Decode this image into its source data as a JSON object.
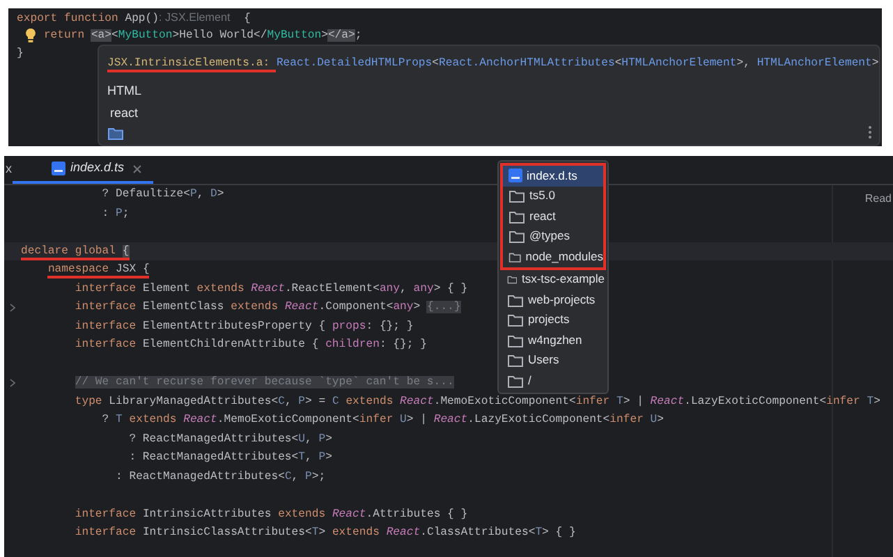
{
  "top_editor": {
    "lines": [
      {
        "kind": "code",
        "tokens": [
          {
            "text": "export function ",
            "kind": "keyword"
          },
          {
            "text": "App()",
            "kind": "plain"
          },
          {
            "text": ": JSX.Element",
            "kind": "hint"
          },
          {
            "text": "  {",
            "kind": "plain"
          }
        ]
      },
      {
        "kind": "code",
        "intention": true,
        "tokens": [
          {
            "text": "    return ",
            "kind": "keyword"
          },
          {
            "text": "<a>",
            "kind": "match"
          },
          {
            "text": "<",
            "kind": "plain"
          },
          {
            "text": "MyButton",
            "kind": "tag"
          },
          {
            "text": ">Hello World</",
            "kind": "plain"
          },
          {
            "text": "MyButton",
            "kind": "tag"
          },
          {
            "text": ">",
            "kind": "plain"
          },
          {
            "text": "</a>",
            "kind": "match"
          },
          {
            "text": ";",
            "kind": "plain"
          }
        ]
      },
      {
        "kind": "code",
        "tokens": [
          {
            "text": "}",
            "kind": "plain"
          }
        ]
      }
    ],
    "doc_popup": {
      "signature": [
        {
          "text": "JSX.IntrinsicElements.a: ",
          "kind": "sig-name",
          "underlined": true
        },
        {
          "text": "React.DetailedHTMLProps",
          "kind": "sig-type"
        },
        {
          "text": "<",
          "kind": "plain"
        },
        {
          "text": "React.AnchorHTMLAttributes",
          "kind": "sig-type"
        },
        {
          "text": "<",
          "kind": "plain"
        },
        {
          "text": "HTMLAnchorElement",
          "kind": "sig-type"
        },
        {
          "text": ">, ",
          "kind": "plain"
        },
        {
          "text": "HTMLAnchorElement",
          "kind": "sig-type"
        },
        {
          "text": ">",
          "kind": "plain"
        }
      ],
      "library": "HTML",
      "module": "react"
    }
  },
  "bottom_editor": {
    "tabs": [
      {
        "label": "x",
        "kind": "plain",
        "selected": false
      },
      {
        "label": "index.d.ts",
        "kind": "typescript",
        "selected": true
      }
    ],
    "side_label": "Read",
    "lines": [
      {
        "kind": "code",
        "tokens": [
          {
            "text": "            ? Defaultize<",
            "kind": "plain"
          },
          {
            "text": "P",
            "kind": "param"
          },
          {
            "text": ", ",
            "kind": "plain"
          },
          {
            "text": "D",
            "kind": "param"
          },
          {
            "text": ">",
            "kind": "plain"
          }
        ]
      },
      {
        "kind": "code",
        "tokens": [
          {
            "text": "            : ",
            "kind": "plain"
          },
          {
            "text": "P",
            "kind": "param"
          },
          {
            "text": ";",
            "kind": "plain"
          }
        ]
      },
      {
        "kind": "blank"
      },
      {
        "kind": "code",
        "current": true,
        "tokens": [
          {
            "text": "declare global ",
            "kind": "keyword",
            "underlined": true
          },
          {
            "text": "{",
            "kind": "match",
            "underlined": true
          }
        ]
      },
      {
        "kind": "code",
        "tokens": [
          {
            "text": "    namespace ",
            "kind": "keyword",
            "underlined": true
          },
          {
            "text": "JSX {",
            "kind": "plain",
            "underlined": true
          }
        ]
      },
      {
        "kind": "code",
        "tokens": [
          {
            "text": "        interface ",
            "kind": "keyword"
          },
          {
            "text": "Element ",
            "kind": "plain"
          },
          {
            "text": "extends ",
            "kind": "keyword"
          },
          {
            "text": "React",
            "kind": "namespace"
          },
          {
            "text": ".ReactElement<",
            "kind": "plain"
          },
          {
            "text": "any",
            "kind": "prop"
          },
          {
            "text": ", ",
            "kind": "plain"
          },
          {
            "text": "any",
            "kind": "prop"
          },
          {
            "text": "> { }",
            "kind": "plain"
          }
        ]
      },
      {
        "kind": "code",
        "foldable": true,
        "tokens": [
          {
            "text": "        interface ",
            "kind": "keyword"
          },
          {
            "text": "ElementClass ",
            "kind": "plain"
          },
          {
            "text": "extends ",
            "kind": "keyword"
          },
          {
            "text": "React",
            "kind": "namespace"
          },
          {
            "text": ".Component<",
            "kind": "plain"
          },
          {
            "text": "any",
            "kind": "prop"
          },
          {
            "text": "> ",
            "kind": "plain"
          },
          {
            "text": "{...}",
            "kind": "folded"
          }
        ]
      },
      {
        "kind": "code",
        "tokens": [
          {
            "text": "        interface ",
            "kind": "keyword"
          },
          {
            "text": "ElementAttributesProperty { ",
            "kind": "plain"
          },
          {
            "text": "props",
            "kind": "prop"
          },
          {
            "text": ": {}; }",
            "kind": "plain"
          }
        ]
      },
      {
        "kind": "code",
        "tokens": [
          {
            "text": "        interface ",
            "kind": "keyword"
          },
          {
            "text": "ElementChildrenAttribute { ",
            "kind": "plain"
          },
          {
            "text": "children",
            "kind": "prop"
          },
          {
            "text": ": {}; }",
            "kind": "plain"
          }
        ]
      },
      {
        "kind": "blank"
      },
      {
        "kind": "code",
        "foldable": true,
        "tokens": [
          {
            "text": "        // We can't recurse forever because `type` can't be s...",
            "kind": "comment"
          }
        ]
      },
      {
        "kind": "code",
        "tokens": [
          {
            "text": "        type ",
            "kind": "keyword"
          },
          {
            "text": "LibraryManagedAttributes<",
            "kind": "plain"
          },
          {
            "text": "C",
            "kind": "param"
          },
          {
            "text": ", ",
            "kind": "plain"
          },
          {
            "text": "P",
            "kind": "param"
          },
          {
            "text": "> = ",
            "kind": "plain"
          },
          {
            "text": "C",
            "kind": "param"
          },
          {
            "text": " extends ",
            "kind": "keyword"
          },
          {
            "text": "React",
            "kind": "namespace"
          },
          {
            "text": ".MemoExoticComponent<",
            "kind": "plain"
          },
          {
            "text": "infer ",
            "kind": "keyword"
          },
          {
            "text": "T",
            "kind": "param"
          },
          {
            "text": "> | ",
            "kind": "plain"
          },
          {
            "text": "React",
            "kind": "namespace"
          },
          {
            "text": ".LazyExoticComponent<",
            "kind": "plain"
          },
          {
            "text": "infer ",
            "kind": "keyword"
          },
          {
            "text": "T",
            "kind": "param"
          },
          {
            "text": ">",
            "kind": "plain"
          }
        ]
      },
      {
        "kind": "code",
        "tokens": [
          {
            "text": "            ? ",
            "kind": "plain"
          },
          {
            "text": "T",
            "kind": "param"
          },
          {
            "text": " extends ",
            "kind": "keyword"
          },
          {
            "text": "React",
            "kind": "namespace"
          },
          {
            "text": ".MemoExoticComponent<",
            "kind": "plain"
          },
          {
            "text": "infer ",
            "kind": "keyword"
          },
          {
            "text": "U",
            "kind": "param"
          },
          {
            "text": "> | ",
            "kind": "plain"
          },
          {
            "text": "React",
            "kind": "namespace"
          },
          {
            "text": ".LazyExoticComponent<",
            "kind": "plain"
          },
          {
            "text": "infer ",
            "kind": "keyword"
          },
          {
            "text": "U",
            "kind": "param"
          },
          {
            "text": ">",
            "kind": "plain"
          }
        ]
      },
      {
        "kind": "code",
        "tokens": [
          {
            "text": "                ? ReactManagedAttributes<",
            "kind": "plain"
          },
          {
            "text": "U",
            "kind": "param"
          },
          {
            "text": ", ",
            "kind": "plain"
          },
          {
            "text": "P",
            "kind": "param"
          },
          {
            "text": ">",
            "kind": "plain"
          }
        ]
      },
      {
        "kind": "code",
        "tokens": [
          {
            "text": "                : ReactManagedAttributes<",
            "kind": "plain"
          },
          {
            "text": "T",
            "kind": "param"
          },
          {
            "text": ", ",
            "kind": "plain"
          },
          {
            "text": "P",
            "kind": "param"
          },
          {
            "text": ">",
            "kind": "plain"
          }
        ]
      },
      {
        "kind": "code",
        "tokens": [
          {
            "text": "              : ReactManagedAttributes<",
            "kind": "plain"
          },
          {
            "text": "C",
            "kind": "param"
          },
          {
            "text": ", ",
            "kind": "plain"
          },
          {
            "text": "P",
            "kind": "param"
          },
          {
            "text": ">;",
            "kind": "plain"
          }
        ]
      },
      {
        "kind": "blank"
      },
      {
        "kind": "code",
        "tokens": [
          {
            "text": "        interface ",
            "kind": "keyword"
          },
          {
            "text": "IntrinsicAttributes ",
            "kind": "plain"
          },
          {
            "text": "extends ",
            "kind": "keyword"
          },
          {
            "text": "React",
            "kind": "namespace"
          },
          {
            "text": ".Attributes { }",
            "kind": "plain"
          }
        ]
      },
      {
        "kind": "code",
        "tokens": [
          {
            "text": "        interface ",
            "kind": "keyword"
          },
          {
            "text": "IntrinsicClassAttributes<",
            "kind": "plain"
          },
          {
            "text": "T",
            "kind": "param"
          },
          {
            "text": "> ",
            "kind": "plain"
          },
          {
            "text": "extends ",
            "kind": "keyword"
          },
          {
            "text": "React",
            "kind": "namespace"
          },
          {
            "text": ".ClassAttributes<",
            "kind": "plain"
          },
          {
            "text": "T",
            "kind": "param"
          },
          {
            "text": "> { }",
            "kind": "plain"
          }
        ]
      }
    ],
    "nav_popup": {
      "items": [
        {
          "label": "index.d.ts",
          "kind": "typescript",
          "selected": true,
          "boxed": true
        },
        {
          "label": "ts5.0",
          "kind": "folder",
          "selected": false,
          "boxed": true
        },
        {
          "label": "react",
          "kind": "folder",
          "selected": false,
          "boxed": true
        },
        {
          "label": "@types",
          "kind": "folder",
          "selected": false,
          "boxed": true
        },
        {
          "label": "node_modules",
          "kind": "folder",
          "selected": false,
          "boxed": true
        },
        {
          "label": "tsx-tsc-example",
          "kind": "folder",
          "selected": false,
          "boxed": false
        },
        {
          "label": "web-projects",
          "kind": "folder",
          "selected": false,
          "boxed": false
        },
        {
          "label": "projects",
          "kind": "folder",
          "selected": false,
          "boxed": false
        },
        {
          "label": "w4ngzhen",
          "kind": "folder",
          "selected": false,
          "boxed": false
        },
        {
          "label": "Users",
          "kind": "folder",
          "selected": false,
          "boxed": false
        },
        {
          "label": "/",
          "kind": "folder",
          "selected": false,
          "boxed": false
        }
      ]
    }
  }
}
